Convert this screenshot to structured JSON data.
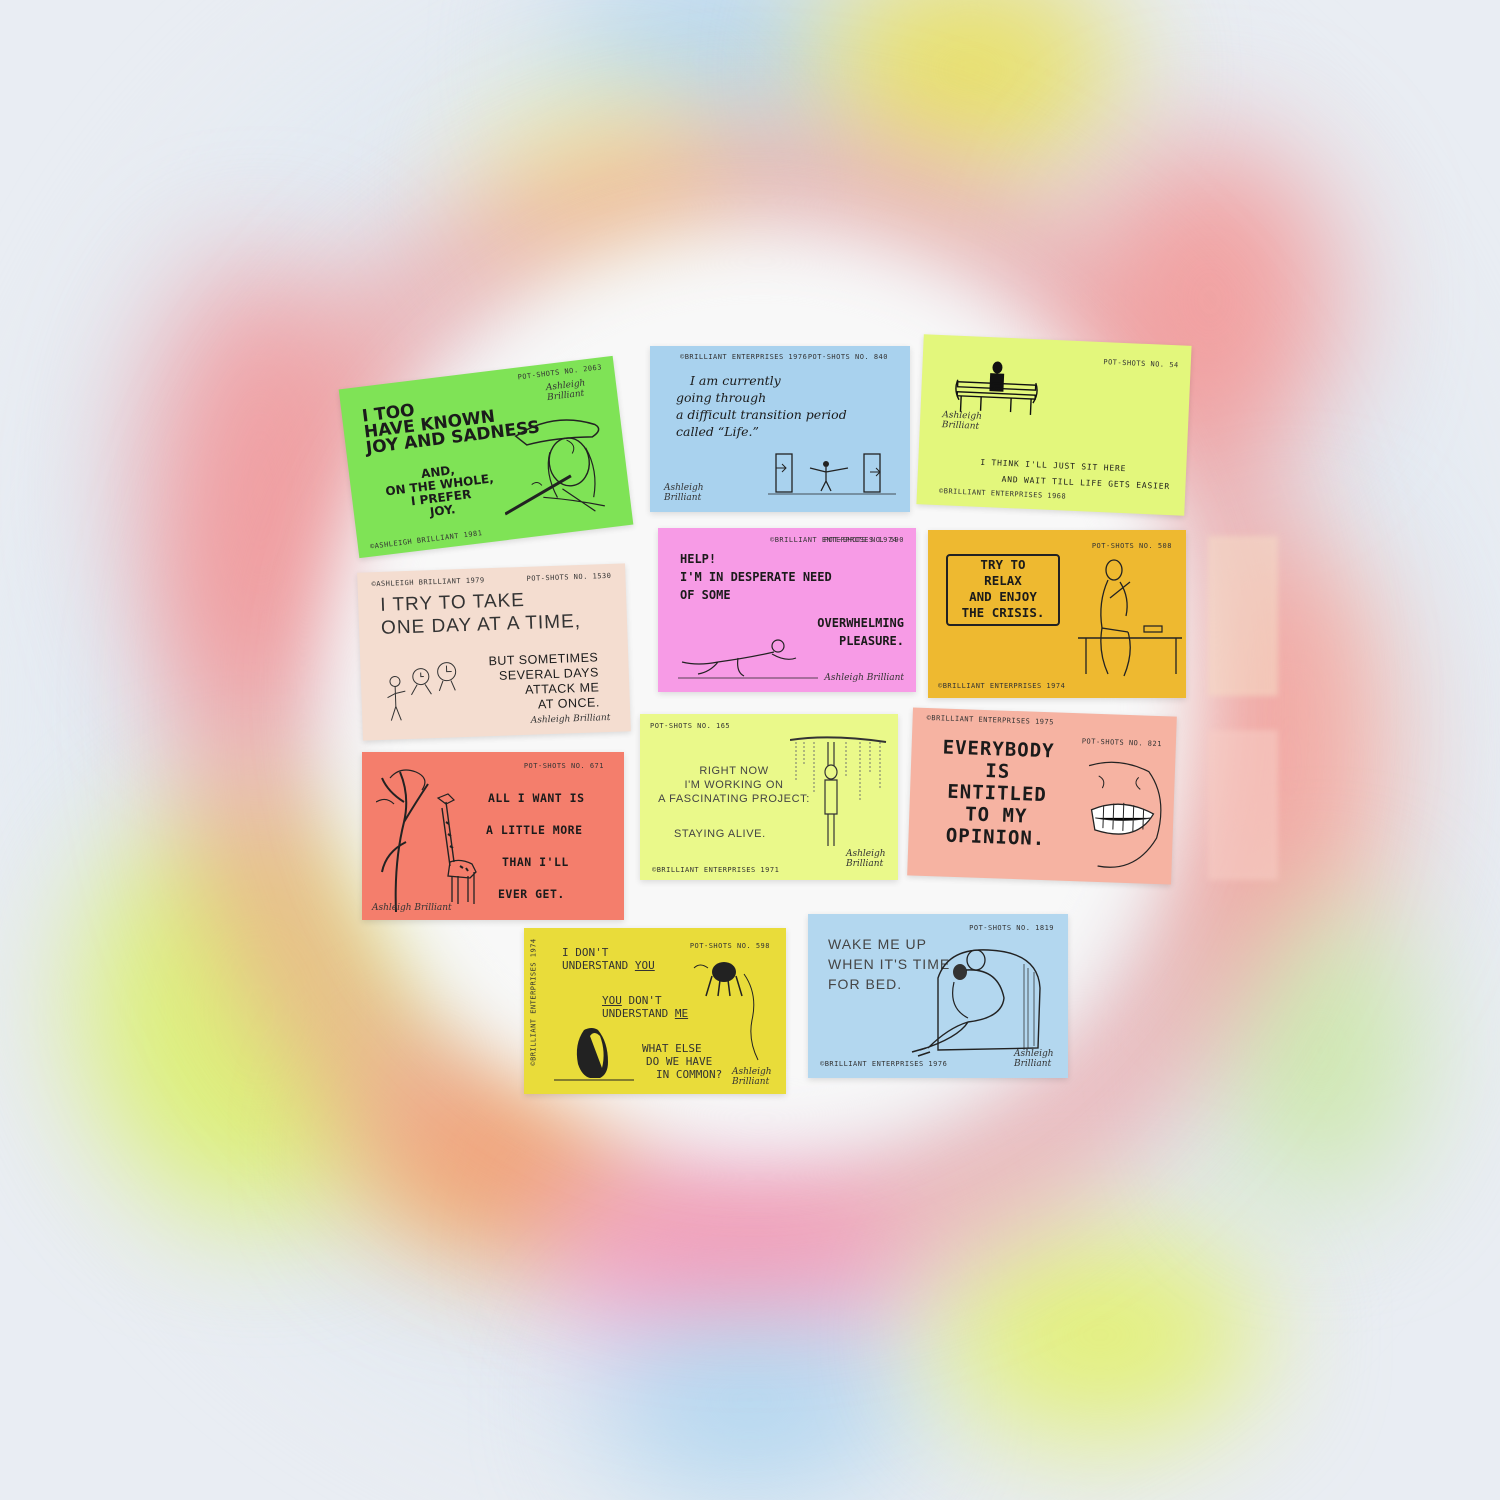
{
  "colors": {
    "green": "#7fe356",
    "blue": "#a9d2ee",
    "lime": "#e3f77c",
    "pink": "#f79be6",
    "mustard": "#eeb930",
    "beige": "#f4ddd0",
    "coral": "#f47e6c",
    "pale_lime": "#eaf98a",
    "salmon": "#f6b3a2",
    "yellow": "#e9dc3a",
    "light_blue": "#b3d7ef"
  },
  "cards": {
    "joy": {
      "meta": "POT-SHOTS NO. 2063",
      "sig": "Ashleigh Brilliant",
      "headline": [
        "I TOO",
        "HAVE KNOWN",
        "JOY AND SADNESS"
      ],
      "body": [
        "AND,",
        "ON THE WHOLE,",
        "I PREFER",
        "JOY."
      ],
      "copyright": "©ASHLEIGH BRILLIANT 1981",
      "icon": "flute-player-icon"
    },
    "life": {
      "meta_left": "©BRILLIANT ENTERPRISES 1976",
      "meta_right": "POT-SHOTS NO. 840",
      "lines": [
        "I am currently",
        "going through",
        "a difficult transition period",
        "called “Life.”"
      ],
      "sig": "Ashleigh Brilliant",
      "icon": "doorways-icon"
    },
    "bench": {
      "meta": "POT-SHOTS NO. 54",
      "sig": "Ashleigh Brilliant",
      "lines": [
        "I THINK I'LL JUST SIT HERE",
        "AND WAIT TILL LIFE GETS EASIER"
      ],
      "copyright": "©BRILLIANT ENTERPRISES 1968",
      "icon": "bench-sitter-icon"
    },
    "help": {
      "meta_left": "©BRILLIANT ENTERPRISES 1974",
      "meta_right": "POT-SHOTS NO. 590",
      "lines_left": [
        "HELP!",
        "I'M IN DESPERATE NEED",
        "OF SOME"
      ],
      "lines_right": [
        "OVERWHELMING",
        "PLEASURE."
      ],
      "sig": "Ashleigh Brilliant",
      "icon": "crawling-man-icon"
    },
    "relax": {
      "meta": "POT-SHOTS NO. 508",
      "sign_lines": [
        "TRY TO",
        "RELAX",
        "AND ENJOY",
        "THE CRISIS."
      ],
      "copyright": "©BRILLIANT ENTERPRISES 1974",
      "icon": "sitting-man-icon"
    },
    "oneday": {
      "meta_left": "©ASHLEIGH BRILLIANT 1979",
      "meta_right": "POT-SHOTS NO. 1530",
      "headline": [
        "I TRY TO TAKE",
        "ONE DAY AT A TIME,"
      ],
      "body": [
        "BUT SOMETIMES",
        "SEVERAL DAYS",
        "ATTACK ME",
        "AT ONCE."
      ],
      "sig": "Ashleigh Brilliant",
      "icon": "clock-creatures-icon"
    },
    "giraffe": {
      "meta": "POT-SHOTS NO. 671",
      "lines": [
        "ALL I WANT IS",
        "A LITTLE MORE",
        "THAN I'LL",
        "EVER GET."
      ],
      "sig": "Ashleigh Brilliant",
      "icon": "giraffe-icon"
    },
    "project": {
      "meta": "POT-SHOTS NO. 165",
      "lines": [
        "RIGHT NOW",
        "I'M WORKING ON",
        "A FASCINATING PROJECT:"
      ],
      "punch": "STAYING ALIVE.",
      "sig": "Ashleigh Brilliant",
      "copyright": "©BRILLIANT ENTERPRISES 1971",
      "icon": "hanging-man-icon"
    },
    "opinion": {
      "meta_left": "©BRILLIANT ENTERPRISES 1975",
      "meta_right": "POT-SHOTS NO. 821",
      "lines": [
        "EVERYBODY",
        "IS",
        "ENTITLED",
        "TO MY",
        "OPINION."
      ],
      "icon": "grinning-mouth-icon"
    },
    "common": {
      "meta": "POT-SHOTS NO. 598",
      "side": "©BRILLIANT ENTERPRISES 1974",
      "line1a": "I DON'T",
      "line1b": "UNDERSTAND",
      "line1c": "YOU",
      "line2a": "YOU",
      "line2b": "DON'T",
      "line2c": "UNDERSTAND",
      "line2d": "ME",
      "line3": [
        "WHAT ELSE",
        "DO WE HAVE",
        "IN COMMON?"
      ],
      "sig": "Ashleigh Brilliant",
      "icon": "penguin-walrus-icon"
    },
    "bed": {
      "meta": "POT-SHOTS NO. 1819",
      "lines": [
        "WAKE ME UP",
        "WHEN IT'S TIME",
        "FOR BED."
      ],
      "copyright": "©BRILLIANT ENTERPRISES 1976",
      "sig": "Ashleigh Brilliant",
      "icon": "armchair-couple-icon"
    }
  }
}
